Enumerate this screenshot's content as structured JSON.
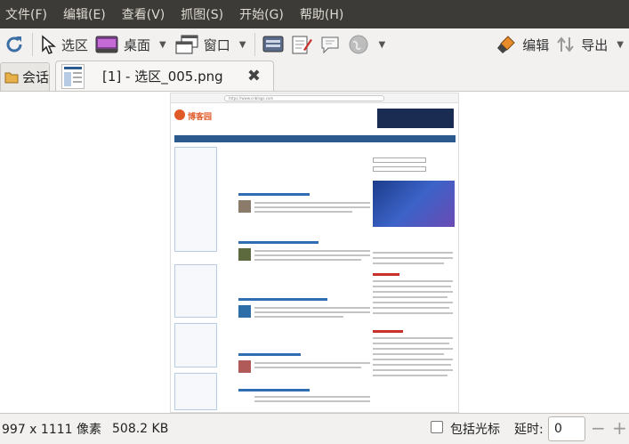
{
  "menu": {
    "items": [
      "文件(F)",
      "编辑(E)",
      "查看(V)",
      "抓图(S)",
      "开始(G)",
      "帮助(H)"
    ]
  },
  "toolbar": {
    "select_label": "选区",
    "desktop_label": "桌面",
    "window_label": "窗口",
    "edit_label": "编辑",
    "export_label": "导出"
  },
  "tabs": {
    "side_label": "会话",
    "main_title": "[1] - 选区_005.png"
  },
  "screenshot": {
    "url_text": "https://www.cnblogs.com",
    "site_name": "博客园"
  },
  "status": {
    "dimensions": "997 x 1111 像素",
    "file_size": "508.2 KB",
    "include_cursor_label": "包括光标",
    "delay_label": "延时:",
    "delay_value": "0",
    "minus_label": "−",
    "plus_label": "+"
  },
  "colors": {
    "menubar_bg": "#3c3b37",
    "menubar_text": "#dfdbd2",
    "site_accent": "#e05a28",
    "site_nav": "#2c5a8f"
  }
}
